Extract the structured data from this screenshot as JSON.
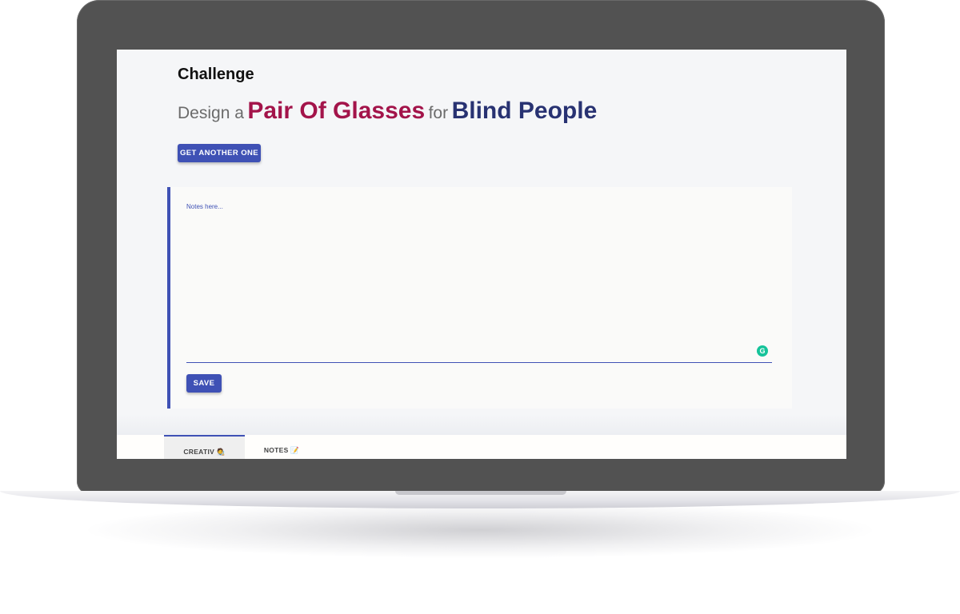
{
  "app": {
    "heading": "Challenge",
    "prompt": {
      "prefix": "Design a",
      "object": "Pair Of Glasses",
      "connector": "for",
      "audience": "Blind People"
    },
    "new_challenge_label": "GET ANOTHER ONE",
    "notes": {
      "placeholder": "Notes here...",
      "value": ""
    },
    "save_label": "SAVE",
    "grammarly_icon_letter": "G",
    "tabs": [
      {
        "label": "CREATIV 🧑‍🎨",
        "active": true
      },
      {
        "label": "NOTES 📝",
        "active": false
      }
    ]
  },
  "colors": {
    "primary": "#3f51b5",
    "accent_red": "#a3144a",
    "accent_blue": "#283272",
    "grammarly": "#15c39a",
    "laptop_frame": "#525252"
  }
}
